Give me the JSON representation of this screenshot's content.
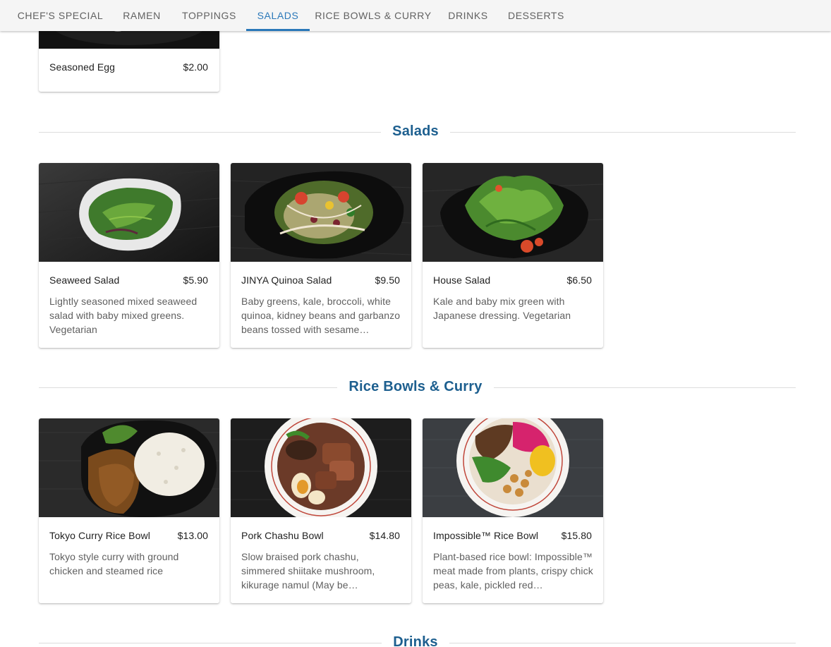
{
  "tabs": [
    {
      "label": "CHEF'S SPECIAL"
    },
    {
      "label": "RAMEN"
    },
    {
      "label": "TOPPINGS"
    },
    {
      "label": "SALADS"
    },
    {
      "label": "RICE BOWLS & CURRY"
    },
    {
      "label": "DRINKS"
    },
    {
      "label": "DESSERTS"
    }
  ],
  "active_tab": "SALADS",
  "colors": {
    "accent": "#2a78b9",
    "section_title": "#1d5f8f"
  },
  "toppings": {
    "items": [
      {
        "name": "Seasoned Egg",
        "price": "$2.00",
        "image": "seasoned-egg-photo"
      }
    ]
  },
  "salads": {
    "title": "Salads",
    "items": [
      {
        "name": "Seaweed Salad",
        "price": "$5.90",
        "description": "Lightly seasoned mixed seaweed salad with baby mixed greens. Vegetarian",
        "image": "seaweed-salad-photo"
      },
      {
        "name": "JINYA Quinoa Salad",
        "price": "$9.50",
        "description": "Baby greens, kale, broccoli, white quinoa, kidney beans and garbanzo beans tossed with sesame…",
        "image": "quinoa-salad-photo"
      },
      {
        "name": "House Salad",
        "price": "$6.50",
        "description": "Kale and baby mix green with Japanese dressing. Vegetarian",
        "image": "house-salad-photo"
      }
    ]
  },
  "rice_bowls": {
    "title": "Rice Bowls & Curry",
    "items": [
      {
        "name": "Tokyo Curry Rice Bowl",
        "price": "$13.00",
        "description": "Tokyo style curry with ground chicken and steamed rice",
        "image": "curry-rice-photo"
      },
      {
        "name": "Pork Chashu Bowl",
        "price": "$14.80",
        "description": "Slow braised pork chashu, simmered shiitake mushroom, kikurage namul (May be…",
        "image": "chashu-bowl-photo"
      },
      {
        "name": "Impossible™ Rice Bowl",
        "price": "$15.80",
        "description": "Plant-based rice bowl: Impossible™ meat made from plants, crispy chick peas, kale, pickled red…",
        "image": "impossible-bowl-photo"
      }
    ]
  },
  "drinks": {
    "title": "Drinks"
  }
}
